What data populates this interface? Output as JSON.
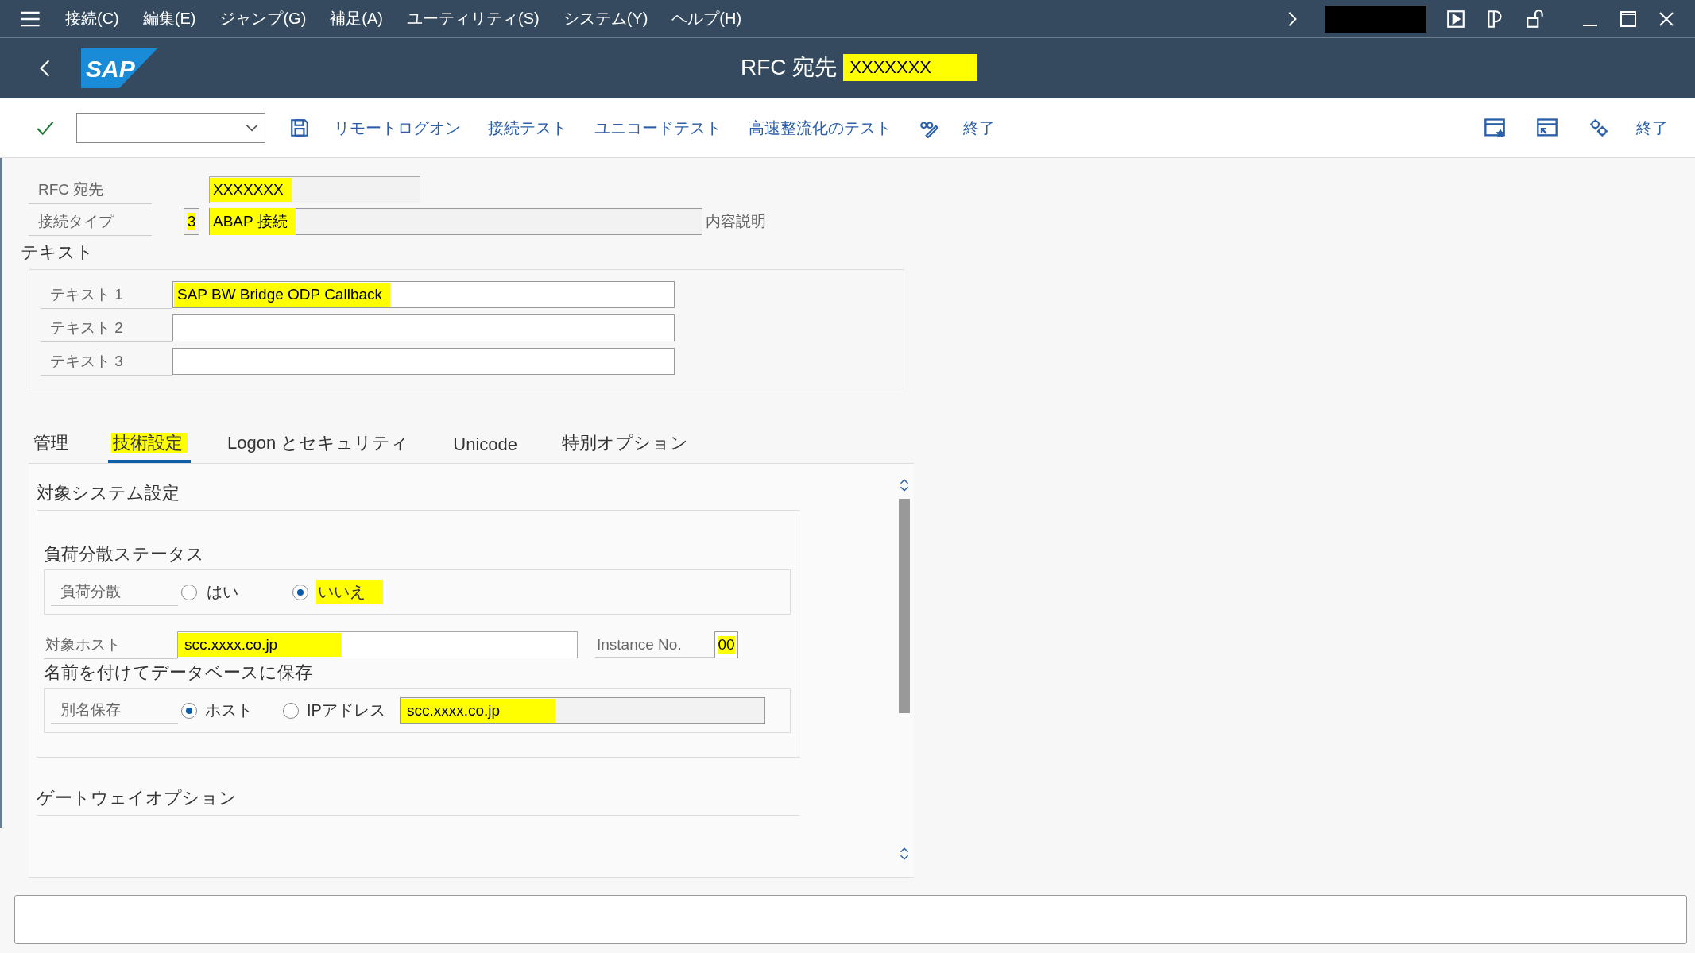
{
  "menu_bar": {
    "items": [
      "接続(C)",
      "編集(E)",
      "ジャンプ(G)",
      "補足(A)",
      "ユーティリティ(S)",
      "システム(Y)",
      "ヘルプ(H)"
    ]
  },
  "header": {
    "logo": "SAP",
    "title": "RFC 宛先",
    "destination": {
      "text": "XXXXXXX",
      "highlighted": true
    }
  },
  "toolbar": {
    "buttons": [
      "リモートログオン",
      "接続テスト",
      "ユニコードテスト",
      "高速整流化のテスト"
    ],
    "exit": "終了",
    "right_exit": "終了"
  },
  "destination_field": {
    "label": "RFC 宛先",
    "value": "XXXXXXX",
    "highlighted": true
  },
  "connection_type": {
    "label": "接続タイプ",
    "code": "3",
    "description": "ABAP 接続",
    "highlighted": true,
    "suffix": "内容説明"
  },
  "text_group": {
    "title": "テキスト",
    "fields": [
      {
        "label": "テキスト 1",
        "value": "SAP BW Bridge ODP Callback",
        "highlighted": true
      },
      {
        "label": "テキスト 2"
      },
      {
        "label": "テキスト 3"
      }
    ]
  },
  "tabs": [
    {
      "label": "管理",
      "selected": false,
      "highlighted": false
    },
    {
      "label": "技術設定",
      "selected": true,
      "highlighted": true
    },
    {
      "label": "Logon とセキュリティ",
      "selected": false,
      "highlighted": false
    },
    {
      "label": "Unicode",
      "selected": false,
      "highlighted": false
    },
    {
      "label": "特別オプション",
      "selected": false,
      "highlighted": false
    }
  ],
  "panel": {
    "section_title": "対象システム設定",
    "load_balancing": {
      "title": "負荷分散ステータス",
      "label": "負荷分散",
      "options": [
        {
          "label": "はい",
          "selected": false,
          "highlighted": false
        },
        {
          "label": "いいえ",
          "selected": true,
          "highlighted": true
        }
      ]
    },
    "target_host": {
      "label": "対象ホスト",
      "value": "scc.xxxx.co.jp",
      "highlighted": true
    },
    "instance": {
      "label": "Instance No.",
      "value": "00",
      "highlighted": true
    },
    "save_group": {
      "title": "名前を付けてデータベースに保存",
      "label": "別名保存",
      "options": [
        {
          "label": "ホスト",
          "selected": true
        },
        {
          "label": "IPアドレス",
          "selected": false
        }
      ],
      "value": "scc.xxxx.co.jp",
      "highlighted": true
    },
    "gateway_title": "ゲートウェイオプション"
  }
}
